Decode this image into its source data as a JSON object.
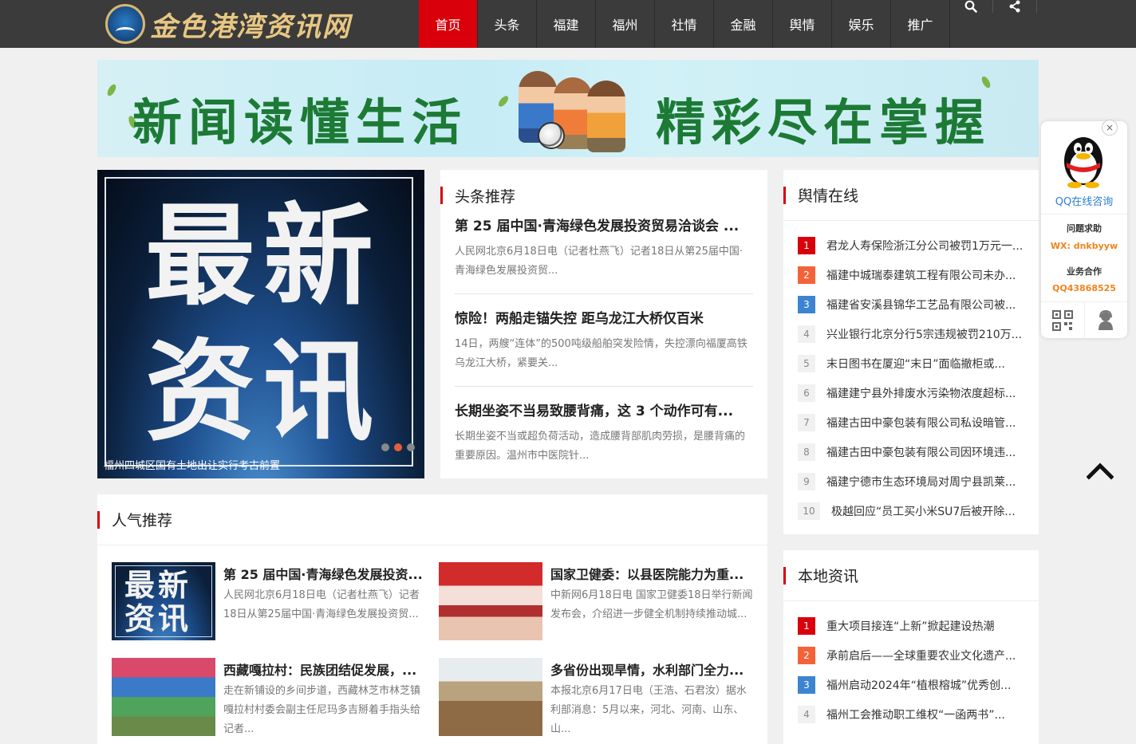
{
  "site": {
    "logo_text": "金色港湾资讯网"
  },
  "nav": {
    "items": [
      "首页",
      "头条",
      "福建",
      "福州",
      "社情",
      "金融",
      "舆情",
      "娱乐",
      "推广"
    ],
    "active_index": 0
  },
  "banner": {
    "left_slogan": "新闻读懂生活",
    "right_slogan": "精彩尽在掌握"
  },
  "slider": {
    "big_line1": "最新",
    "big_line2": "资讯",
    "caption": "福州四城区国有土地出让实行考古前置",
    "dots": 3,
    "active_dot": 1
  },
  "headlines": {
    "title": "头条推荐",
    "items": [
      {
        "title": "第 25 届中国·青海绿色发展投资贸易洽谈会 ...",
        "desc": "人民网北京6月18日电（记者杜燕飞）记者18日从第25届中国·青海绿色发展投资贸..."
      },
      {
        "title": "惊险！两船走锚失控 距乌龙江大桥仅百米",
        "desc": "14日，两艘“连体”的500吨级船舶突发险情，失控漂向福厦高铁乌龙江大桥，紧要关..."
      },
      {
        "title": "长期坐姿不当易致腰背痛，这 3 个动作可有...",
        "desc": "长期坐姿不当或超负荷活动，造成腰背部肌肉劳损，是腰背痛的重要原因。温州市中医院针..."
      }
    ]
  },
  "opinion": {
    "title": "舆情在线",
    "items": [
      "君龙人寿保险浙江分公司被罚1万元一...",
      "福建中城瑞泰建筑工程有限公司未办...",
      "福建省安溪县锦华工艺品有限公司被...",
      "兴业银行北京分行5宗违规被罚210万...",
      "末日图书在厦迎“末日”面临撤柜或...",
      "福建建宁县外排废水污染物浓度超标...",
      "福建古田中豪包装有限公司私设暗管...",
      "福建古田中豪包装有限公司因环境违...",
      "福建宁德市生态环境局对周宁县凯莱...",
      "极越回应“员工买小米SU7后被开除..."
    ]
  },
  "local": {
    "title": "本地资讯",
    "items": [
      "重大项目接连“上新”掀起建设热潮",
      "承前启后——全球重要农业文化遗产...",
      "福州启动2024年“植根榕城”优秀创...",
      "福州工会推动职工维权“一函两书”..."
    ]
  },
  "popular": {
    "title": "人气推荐",
    "items": [
      {
        "title": "第 25 届中国·青海绿色发展投资...",
        "desc": "人民网北京6月18日电（记者杜燕飞）记者18日从第25届中国·青海绿色发展投资贸...",
        "thumb_text": "最新资讯"
      },
      {
        "title": "国家卫健委：以县医院能力为重...",
        "desc": "中新网6月18日电 国家卫健委18日举行新闻发布会，介绍进一步健全机制持续推动城..."
      },
      {
        "title": "西藏嘎拉村：民族团结促发展，...",
        "desc": "走在新铺设的乡间步道，西藏林芝市林芝镇嘎拉村村委会副主任尼玛多吉掰着手指头给记者..."
      },
      {
        "title": "多省份出现旱情，水利部门全力...",
        "desc": "本报北京6月17日电（王浩、石君汝）据水利部消息：5月以来，河北、河南、山东、山..."
      }
    ]
  },
  "qq_widget": {
    "link": "QQ在线咨询",
    "label1": "问题求助",
    "value1": "WX: dnkbyyw",
    "label2": "业务合作",
    "value2": "QQ43868525",
    "close": "×"
  },
  "colors": {
    "accent": "#d9000b",
    "header_bg": "#3b3b3b"
  }
}
